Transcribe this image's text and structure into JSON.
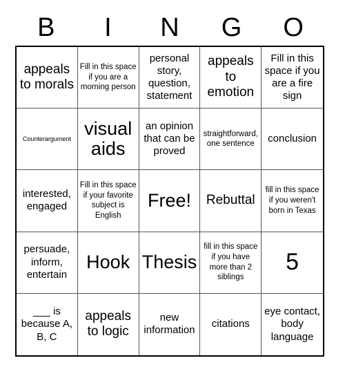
{
  "card": {
    "title": "BINGO",
    "header_letters": [
      "B",
      "I",
      "N",
      "G",
      "O"
    ],
    "grid_size": "5x5",
    "free_space_label": "Free!",
    "colors": {
      "text": "#000000",
      "background": "#ffffff",
      "outer_border": "#000000",
      "inner_gridline": "#555555"
    },
    "cells": [
      {
        "text": "appeals to morals",
        "size": "l"
      },
      {
        "text": "Fill in this space if you are a morning person",
        "size": "s"
      },
      {
        "text": "personal story, question, statement",
        "size": "m"
      },
      {
        "text": "appeals to emotion",
        "size": "l"
      },
      {
        "text": "Fill in this space if you are a fire sign",
        "size": "m"
      },
      {
        "text": "Counterargument",
        "size": "xs"
      },
      {
        "text": "visual aids",
        "size": "xl"
      },
      {
        "text": "an opinion that can be proved",
        "size": "m"
      },
      {
        "text": "straightforward, one sentence",
        "size": "s"
      },
      {
        "text": "conclusion",
        "size": "m"
      },
      {
        "text": "interested, engaged",
        "size": "m"
      },
      {
        "text": "Fill in this space if your favorite subject is English",
        "size": "s"
      },
      {
        "text": "Free!",
        "size": "xl"
      },
      {
        "text": "Rebuttal",
        "size": "l"
      },
      {
        "text": "fill in this space if you weren't born in Texas",
        "size": "s"
      },
      {
        "text": "persuade, inform, entertain",
        "size": "m"
      },
      {
        "text": "Hook",
        "size": "xl"
      },
      {
        "text": "Thesis",
        "size": "xl"
      },
      {
        "text": "fill in this space if you have more than 2 siblings",
        "size": "s"
      },
      {
        "text": "5",
        "size": "xxl"
      },
      {
        "text": "___ is because A, B, C",
        "size": "m"
      },
      {
        "text": "appeals to logic",
        "size": "l"
      },
      {
        "text": "new information",
        "size": "m"
      },
      {
        "text": "citations",
        "size": "m"
      },
      {
        "text": "eye contact, body language",
        "size": "m"
      }
    ]
  }
}
